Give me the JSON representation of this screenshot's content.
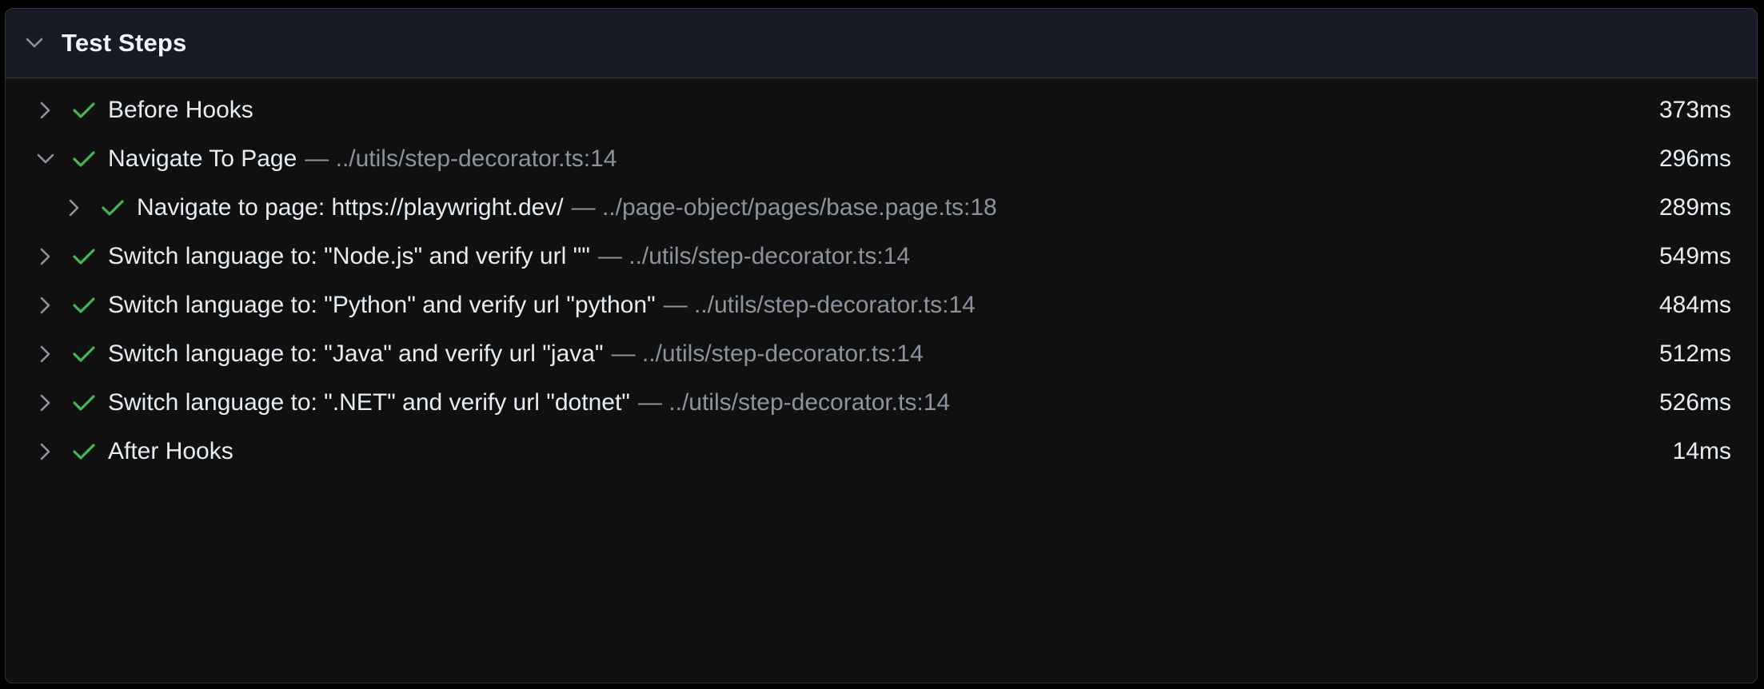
{
  "panel": {
    "title": "Test Steps",
    "expanded_icon": "chevron-down-icon"
  },
  "colors": {
    "success": "#3fb950",
    "text": "#e6edf3",
    "muted": "#8b949e",
    "header_bg": "#161b22",
    "panel_bg": "#101010"
  },
  "steps": [
    {
      "title": "Before Hooks",
      "location": "",
      "duration": "373ms",
      "expanded": false,
      "depth": 0,
      "status": "passed"
    },
    {
      "title": "Navigate To Page",
      "location": "— ../utils/step-decorator.ts:14",
      "duration": "296ms",
      "expanded": true,
      "depth": 0,
      "status": "passed"
    },
    {
      "title": "Navigate to page: https://playwright.dev/",
      "location": "— ../page-object/pages/base.page.ts:18",
      "duration": "289ms",
      "expanded": false,
      "depth": 1,
      "status": "passed"
    },
    {
      "title": "Switch language to: \"Node.js\" and verify url \"\"",
      "location": "— ../utils/step-decorator.ts:14",
      "duration": "549ms",
      "expanded": false,
      "depth": 0,
      "status": "passed"
    },
    {
      "title": "Switch language to: \"Python\" and verify url \"python\"",
      "location": "— ../utils/step-decorator.ts:14",
      "duration": "484ms",
      "expanded": false,
      "depth": 0,
      "status": "passed"
    },
    {
      "title": "Switch language to: \"Java\" and verify url \"java\"",
      "location": "— ../utils/step-decorator.ts:14",
      "duration": "512ms",
      "expanded": false,
      "depth": 0,
      "status": "passed"
    },
    {
      "title": "Switch language to: \".NET\" and verify url \"dotnet\"",
      "location": "— ../utils/step-decorator.ts:14",
      "duration": "526ms",
      "expanded": false,
      "depth": 0,
      "status": "passed"
    },
    {
      "title": "After Hooks",
      "location": "",
      "duration": "14ms",
      "expanded": false,
      "depth": 0,
      "status": "passed"
    }
  ]
}
